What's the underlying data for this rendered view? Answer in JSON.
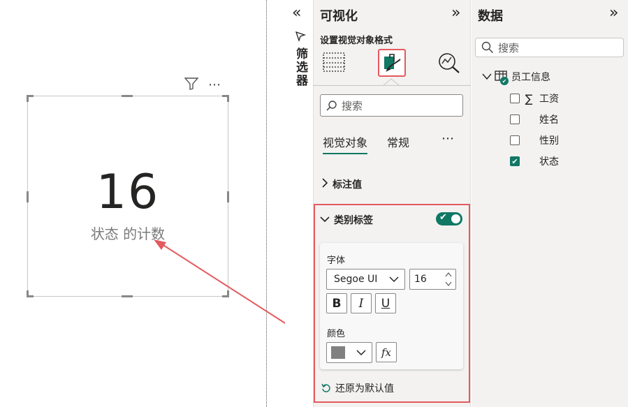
{
  "canvas": {
    "card": {
      "value": "16",
      "label": "状态 的计数"
    },
    "icons": [
      "filter-icon",
      "more-options-icon"
    ],
    "more_dots": "⋯"
  },
  "filters": {
    "title": "筛选器",
    "collapse_icon": "«"
  },
  "viz_pane": {
    "title": "可视化",
    "expand_icon": "»",
    "subtitle": "设置视觉对象格式",
    "format_icons": [
      "table-grid-icon",
      "paint-brush-format-icon",
      "analytics-magnifier-icon"
    ],
    "search_placeholder": "搜索",
    "tabs": [
      {
        "label": "视觉对象"
      },
      {
        "label": "常规"
      }
    ],
    "tabs_more": "⋯",
    "sections": {
      "callout_value": "标注值",
      "category_label": "类别标签"
    },
    "category_label_card": {
      "font_label": "字体",
      "font_family": "Segoe UI",
      "font_size": "16",
      "bold": "B",
      "italic": "I",
      "underline": "U",
      "color_label": "颜色",
      "color_value": "#808080",
      "fx": "fx"
    },
    "reset_label": "还原为默认值",
    "toggle_on": true,
    "accent_color": "#117865",
    "highlight_color": "#e35a5f"
  },
  "data_pane": {
    "title": "数据",
    "expand_icon": "»",
    "search_placeholder": "搜索",
    "table": {
      "name": "员工信息",
      "fields": [
        {
          "name": "工资",
          "checked": false,
          "sigma": "∑"
        },
        {
          "name": "姓名",
          "checked": false,
          "sigma": ""
        },
        {
          "name": "性别",
          "checked": false,
          "sigma": ""
        },
        {
          "name": "状态",
          "checked": true,
          "sigma": ""
        }
      ]
    }
  }
}
